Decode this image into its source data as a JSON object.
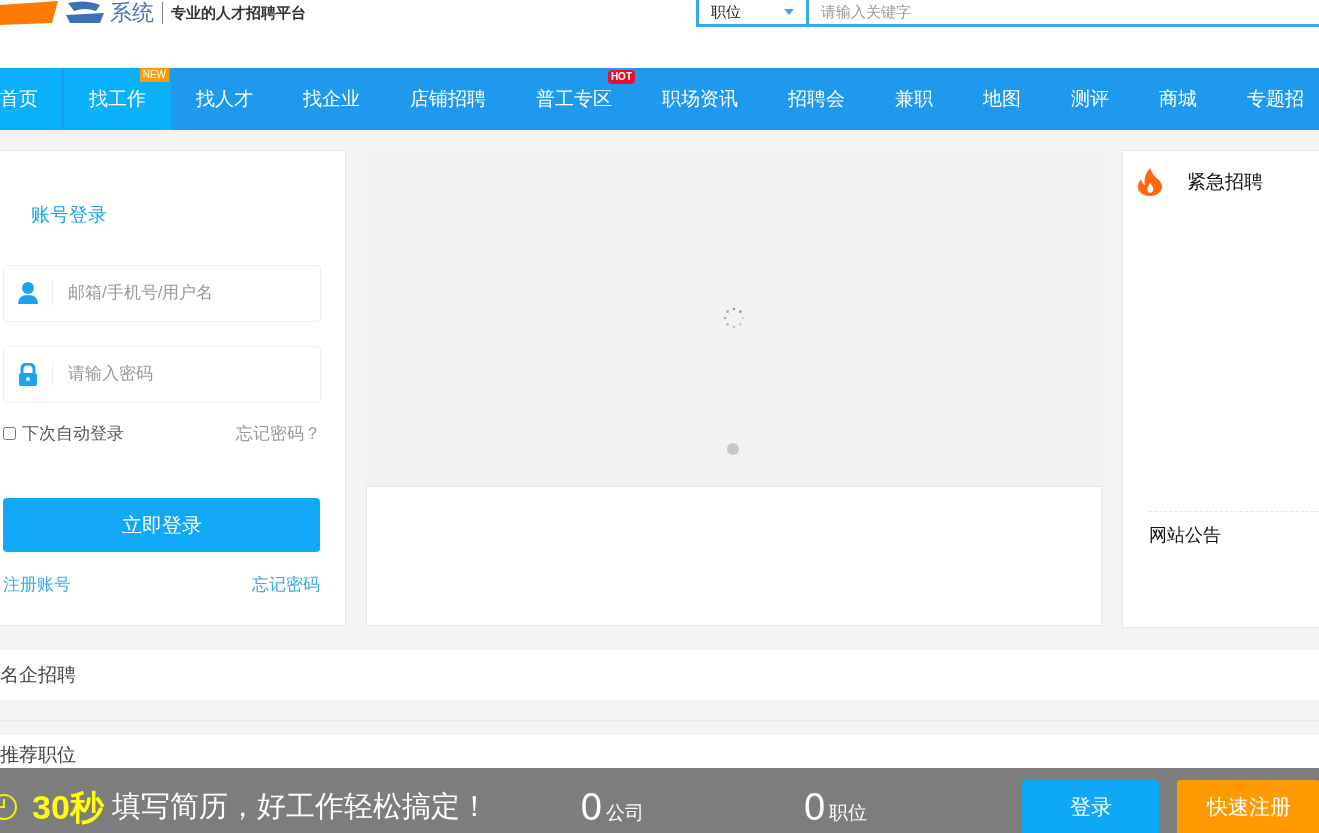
{
  "header": {
    "logo_text": "系统",
    "slogan": "专业的人才招聘平台",
    "search": {
      "category": "职位",
      "placeholder": "请输入关键字"
    }
  },
  "nav": [
    {
      "label": "首页",
      "selected": true
    },
    {
      "label": "找工作",
      "selected": true,
      "badge": {
        "kind": "new",
        "text": "NEW"
      }
    },
    {
      "label": "找人才",
      "selected": false
    },
    {
      "label": "找企业",
      "selected": false
    },
    {
      "label": "店铺招聘",
      "selected": false
    },
    {
      "label": "普工专区",
      "selected": false,
      "badge": {
        "kind": "hot",
        "text": "HOT"
      }
    },
    {
      "label": "职场资讯",
      "selected": false
    },
    {
      "label": "招聘会",
      "selected": false
    },
    {
      "label": "兼职",
      "selected": false
    },
    {
      "label": "地图",
      "selected": false
    },
    {
      "label": "测评",
      "selected": false
    },
    {
      "label": "商城",
      "selected": false
    },
    {
      "label": "专题招",
      "selected": false
    }
  ],
  "login": {
    "title": "账号登录",
    "username_placeholder": "邮箱/手机号/用户名",
    "password_placeholder": "请输入密码",
    "remember": {
      "label": "下次自动登录",
      "checked": false
    },
    "forgot_hint": "忘记密码？",
    "submit": "立即登录",
    "register_link": "注册账号",
    "forgot_link": "忘记密码"
  },
  "right_panel": {
    "urgent_title": "紧急招聘",
    "notice_title": "网站公告"
  },
  "sections": [
    {
      "title": "名企招聘"
    },
    {
      "title": "推荐职位"
    }
  ],
  "bottom_bar": {
    "highlight": "30秒",
    "slogan": "填写简历，好工作轻松搞定！",
    "stats": [
      {
        "value": "0",
        "unit": "公司"
      },
      {
        "value": "0",
        "unit": "职位"
      }
    ],
    "login_button": "登录",
    "register_button": "快速注册"
  }
}
